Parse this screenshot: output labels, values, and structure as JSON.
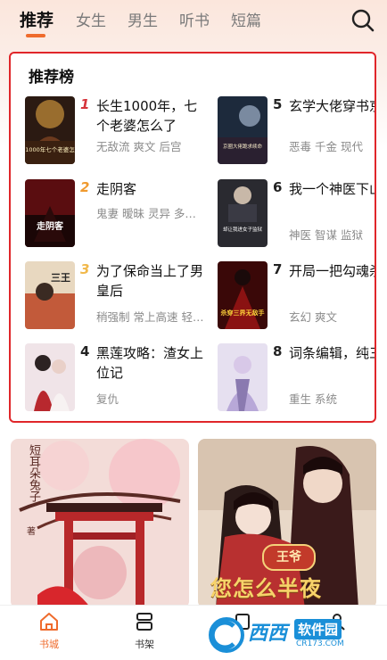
{
  "tabs": [
    "推荐",
    "女生",
    "男生",
    "听书",
    "短篇"
  ],
  "recommend": {
    "title": "推荐榜",
    "items": [
      {
        "rank": "1",
        "title": "长生1000年，七个老婆怎么了",
        "tags": "无敌流 爽文 后宫",
        "cover_text": "长生1000年七个老婆怎么了"
      },
      {
        "rank": "2",
        "title": "走阴客",
        "tags": "鬼妻 暧昧 灵异 多…",
        "cover_text": "走阴客"
      },
      {
        "rank": "3",
        "title": "为了保命当上了男皇后",
        "tags": "稍强制 常上高速 轻…",
        "cover_text": "三王"
      },
      {
        "rank": "4",
        "title": "黑莲攻略：渣女上位记",
        "tags": "复仇",
        "cover_text": ""
      },
      {
        "rank": "5",
        "title": "玄学大佬穿书京圈大佬跪求",
        "tags": "恶毒 千金 现代",
        "cover_text": "京圈大佬跪求续命"
      },
      {
        "rank": "6",
        "title": "我一个神医下山却让我进女子",
        "tags": "神医 智谋 监狱",
        "cover_text": "却让我进女子监狱"
      },
      {
        "rank": "7",
        "title": "开局一把勾魂杀穿三界无敌",
        "tags": "玄幻 爽文",
        "cover_text": "杀穿三界无敌手"
      },
      {
        "rank": "8",
        "title": "词条编辑，纯三天成黑丝御",
        "tags": "重生 系统",
        "cover_text": ""
      }
    ]
  },
  "banners": [
    {
      "author": "短耳朵兔子",
      "tag": "著"
    },
    {
      "seal": "王爷",
      "headline": "您怎么半夜"
    }
  ],
  "bottom_nav": [
    "书城",
    "书架"
  ],
  "watermark": {
    "brand": "西西",
    "label": "软件园",
    "url": "CR173.COM"
  },
  "colors": {
    "accent": "#ef6b2c",
    "highlight_border": "#e0262a"
  }
}
